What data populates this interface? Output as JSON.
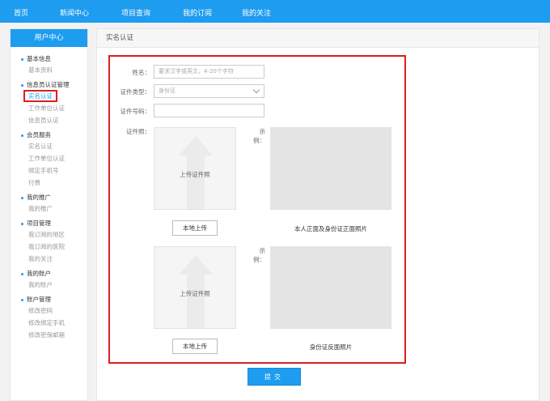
{
  "topnav": {
    "items": [
      {
        "label": "首页"
      },
      {
        "label": "新闻中心"
      },
      {
        "label": "项目查询"
      },
      {
        "label": "我的订阅"
      },
      {
        "label": "我的关注"
      }
    ]
  },
  "sidebar": {
    "title": "用户中心",
    "groups": [
      {
        "title": "基本信息",
        "items": [
          "基本资料"
        ]
      },
      {
        "title": "信息员认证管理",
        "items": [
          "实名认证",
          "工作单位认证",
          "信息员认证"
        ]
      },
      {
        "title": "会员服务",
        "items": [
          "实名认证",
          "工作单位认证",
          "绑定手机号",
          "付费"
        ]
      },
      {
        "title": "我的推广",
        "items": [
          "我的推广"
        ]
      },
      {
        "title": "项目管理",
        "items": [
          "我订阅的地区",
          "我订阅的医院",
          "我的关注"
        ]
      },
      {
        "title": "我的账户",
        "items": [
          "我的账户"
        ]
      },
      {
        "title": "账户管理",
        "items": [
          "修改密码",
          "修改绑定手机",
          "修改密保邮箱"
        ]
      }
    ]
  },
  "main": {
    "title": "实名认证",
    "form": {
      "name_label": "姓名：",
      "name_placeholder": "要求汉字或英文，4-20个字符",
      "idtype_label": "证件类型：",
      "idtype_value": "身份证",
      "idnum_label": "证件号码：",
      "idnum_value": "",
      "photo_label": "证件照：",
      "sample_label": "示例：",
      "upload_text": "上传证件照",
      "upload_button": "本地上传",
      "front_caption": "本人正面及身份证正面照片",
      "back_caption": "身份证反面照片"
    },
    "submit_label": "提交"
  },
  "colors": {
    "accent": "#1d9cf0",
    "highlight": "#d9201d"
  }
}
